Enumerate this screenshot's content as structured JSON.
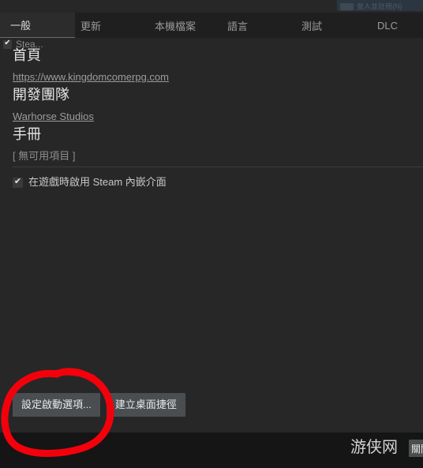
{
  "window": {
    "background_color": "#272727",
    "tabbar_background": "#1f1f1f"
  },
  "top_widget": {
    "label": "登入並註冊(N)",
    "icon": "app-thumbnail-icon"
  },
  "tabs": {
    "active_index": 0,
    "items": [
      {
        "label": "一般"
      },
      {
        "label": "更新"
      },
      {
        "label": "本機檔案"
      },
      {
        "label": "語言"
      },
      {
        "label": "測試"
      },
      {
        "label": "DLC"
      }
    ]
  },
  "top_checkbox": {
    "label": "Stea...",
    "checked": true,
    "check_glyph": "✔"
  },
  "sections": {
    "homepage": {
      "title": "首頁",
      "link": "https://www.kingdomcomerpg.com"
    },
    "developer": {
      "title": "開發團隊",
      "link": "Warhorse Studios"
    },
    "manual": {
      "title": "手冊",
      "note": "[ 無可用項目 ]"
    }
  },
  "overlay_option": {
    "label": "在遊戲時啟用 Steam 內嵌介面",
    "checked": true,
    "check_glyph": "✔"
  },
  "buttons": {
    "launch_options": "設定啟動選項...",
    "desktop_shortcut": "建立桌面捷徑"
  },
  "footer": {
    "watermark": "游侠网",
    "close_label": "關閉"
  },
  "annotation": {
    "type": "hand-drawn-circle",
    "color": "#f4000c",
    "target": "設定啟動選項..."
  }
}
